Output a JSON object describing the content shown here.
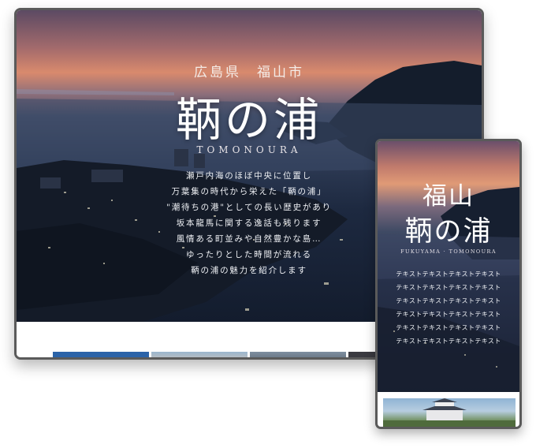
{
  "desktop": {
    "prefecture": "広島県　福山市",
    "title": "鞆の浦",
    "roman": "TOMONOURA",
    "lines": [
      "瀬戸内海のほぼ中央に位置し",
      "万葉集の時代から栄えた「鞆の浦」",
      "\"潮待ちの港\"としての長い歴史があり",
      "坂本龍馬に関する逸話も残ります",
      "風情ある町並みや自然豊かな島…",
      "ゆったりとした時間が流れる",
      "鞆の浦の魅力を紹介します"
    ]
  },
  "mobile": {
    "title_line1": "福山",
    "title_line2": "鞆の浦",
    "roman": "FUKUYAMA · TOMONOURA",
    "lines": [
      "テキストテキストテキストテキスト",
      "テキストテキストテキストテキスト",
      "テキストテキストテキストテキスト",
      "テキストテキストテキストテキスト",
      "テキストテキストテキストテキスト",
      "テキストテキストテキストテキスト"
    ]
  }
}
